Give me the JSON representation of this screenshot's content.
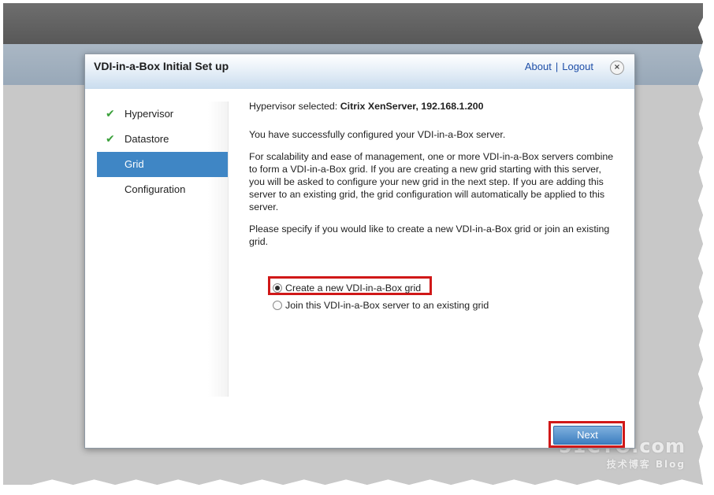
{
  "dialog": {
    "title": "VDI-in-a-Box Initial Set up",
    "links": {
      "about": "About",
      "separator": "|",
      "logout": "Logout"
    },
    "close_glyph": "×"
  },
  "nav": {
    "items": [
      {
        "label": "Hypervisor",
        "status": "done",
        "check": "✔"
      },
      {
        "label": "Datastore",
        "status": "done",
        "check": "✔"
      },
      {
        "label": "Grid",
        "status": "active"
      },
      {
        "label": "Configuration",
        "status": "pending"
      }
    ]
  },
  "content": {
    "hypervisor_prefix": "Hypervisor selected:",
    "hypervisor_value": "Citrix XenServer, 192.168.1.200",
    "success": "You have successfully configured your VDI-in-a-Box server.",
    "description": "For scalability and ease of management, one or more VDI-in-a-Box servers combine to form a VDI-in-a-Box grid. If you are creating a new grid starting with this server, you will be asked to configure your new grid in the next step. If you are adding this server to an existing grid, the grid configuration will automatically be applied to this server.",
    "prompt": "Please specify if you would like to create a new VDI-in-a-Box grid or join an existing grid."
  },
  "options": [
    {
      "label": "Create a new VDI-in-a-Box grid",
      "selected": true
    },
    {
      "label": "Join this VDI-in-a-Box server to an existing grid",
      "selected": false
    }
  ],
  "next_button": "Next",
  "watermark": {
    "line1": "51CTO.com",
    "line2": "技术博客  Blog"
  },
  "colors": {
    "accent": "#3f86c5",
    "highlight": "#d01818",
    "check": "#3aa03a",
    "link": "#1f4fa8"
  }
}
